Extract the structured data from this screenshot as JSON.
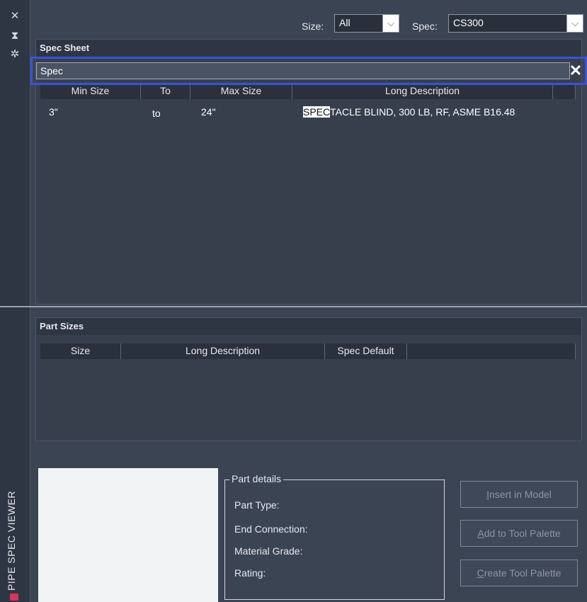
{
  "side": {
    "title": "PIPE SPEC VIEWER",
    "tools": [
      "close-icon",
      "pin-icon",
      "settings-icon"
    ]
  },
  "topbar": {
    "size_label": "Size:",
    "size_value": "All",
    "spec_label": "Spec:",
    "spec_value": "CS300"
  },
  "spec_sheet": {
    "title": "Spec Sheet",
    "search_value": "Spec",
    "columns": [
      "Min Size",
      "To",
      "Max Size",
      "Long Description"
    ],
    "rows": [
      {
        "min": "3\"",
        "to": "to",
        "max": "24\"",
        "desc_match": "SPEC",
        "desc_rest": "TACLE BLIND, 300 LB, RF, ASME B16.48"
      }
    ]
  },
  "part_sizes": {
    "title": "Part Sizes",
    "columns": [
      "Size",
      "Long Description",
      "Spec Default"
    ]
  },
  "part_details": {
    "legend": "Part details",
    "fields": [
      "Part Type:",
      "End Connection:",
      "Material Grade:",
      "Rating:"
    ]
  },
  "buttons": {
    "insert": {
      "mnemonic": "I",
      "rest": "nsert in Model"
    },
    "add": {
      "mnemonic": "A",
      "rest": "dd to Tool Palette"
    },
    "create": {
      "mnemonic": "C",
      "rest": "reate Tool Palette"
    }
  },
  "colors": {
    "background": "#3b4453",
    "search_focus_border": "#3a52d6",
    "highlight": "#ffffff"
  }
}
